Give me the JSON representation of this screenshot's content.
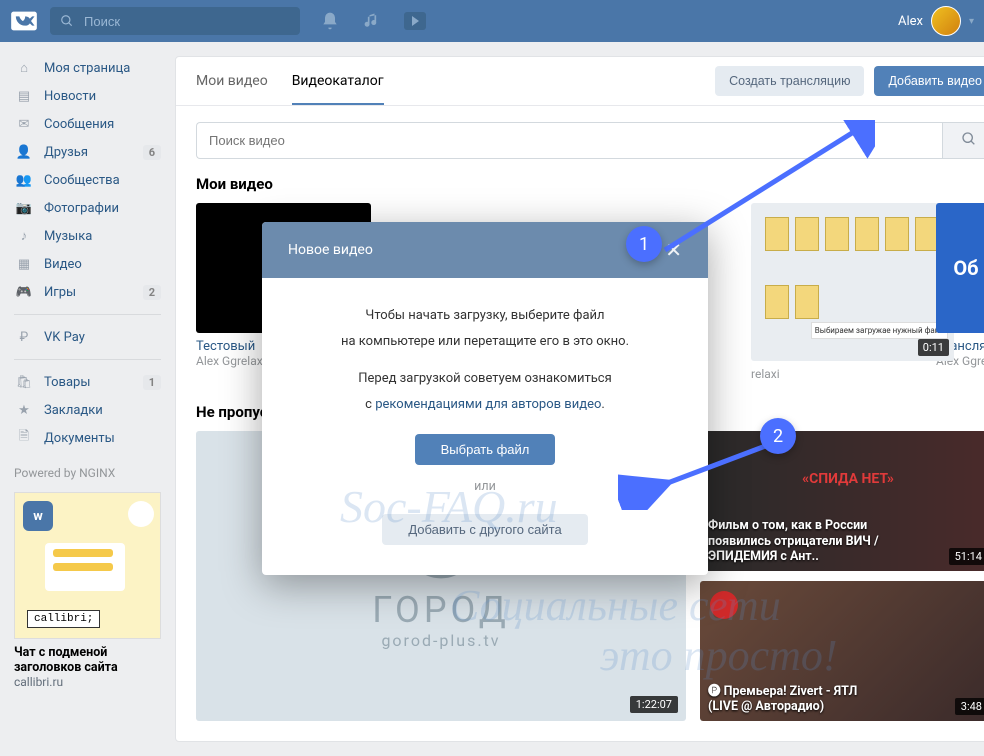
{
  "header": {
    "search_placeholder": "Поиск",
    "username": "Alex"
  },
  "sidebar": {
    "items": [
      {
        "icon": "home",
        "label": "Моя страница"
      },
      {
        "icon": "news",
        "label": "Новости"
      },
      {
        "icon": "msg",
        "label": "Сообщения"
      },
      {
        "icon": "friends",
        "label": "Друзья",
        "badge": "6"
      },
      {
        "icon": "groups",
        "label": "Сообщества"
      },
      {
        "icon": "photos",
        "label": "Фотографии"
      },
      {
        "icon": "music",
        "label": "Музыка"
      },
      {
        "icon": "video",
        "label": "Видео"
      },
      {
        "icon": "games",
        "label": "Игры",
        "badge": "2"
      }
    ],
    "items2": [
      {
        "icon": "pay",
        "label": "VK Pay"
      }
    ],
    "items3": [
      {
        "icon": "goods",
        "label": "Товары",
        "badge": "1"
      },
      {
        "icon": "book",
        "label": "Закладки"
      },
      {
        "icon": "docs",
        "label": "Документы"
      }
    ],
    "powered": "Powered by NGINX",
    "ad": {
      "title": "Чат с подменой заголовков сайта",
      "sub": "callibri.ru",
      "brand": "callibri;"
    }
  },
  "tabs": {
    "my": "Мои видео",
    "catalog": "Видеокаталог",
    "create_stream": "Создать трансляцию",
    "add_video": "Добавить видео"
  },
  "video_search_placeholder": "Поиск видео",
  "section_my": "Мои видео",
  "section_dont_miss": "Не пропустите",
  "my_videos": [
    {
      "title": "Тестовый",
      "author": "Alex Ggrelaxi",
      "dur": ""
    },
    {
      "title": "",
      "author": "",
      "dur": ""
    },
    {
      "title": "",
      "author": "",
      "dur": ""
    },
    {
      "title": "",
      "author": "relaxi",
      "dur": "0:11"
    },
    {
      "title": "Трансляц",
      "author": "Alex Ggrela",
      "dur": ""
    }
  ],
  "big_video": {
    "dur": "1:22:07",
    "brand_top": "ГОРОД",
    "brand_sub": "gorod-plus.tv"
  },
  "side_videos": [
    {
      "title": "Фильм о том, как в России появились отрицатели ВИЧ / ЭПИДЕМИЯ с Ант..",
      "dur": "51:14",
      "tag": "«СПИДА НЕТ»"
    },
    {
      "title": "🅟 Премьера! Zivert - ЯТЛ (LIVE @ Авторадио)",
      "dur": "3:48"
    }
  ],
  "modal": {
    "title": "Новое видео",
    "line1": "Чтобы начать загрузку, выберите файл",
    "line2": "на компьютере или перетащите его в это окно.",
    "line3": "Перед загрузкой советуем ознакомиться",
    "line4_prefix": "с ",
    "line4_link": "рекомендациями для авторов видео",
    "btn_choose": "Выбрать файл",
    "or": "или",
    "btn_other": "Добавить с другого сайта"
  },
  "watermark": {
    "a": "Социальные сети",
    "b": "это просто!",
    "c": "Soc-FAQ.ru"
  },
  "markers": {
    "one": "1",
    "two": "2"
  }
}
